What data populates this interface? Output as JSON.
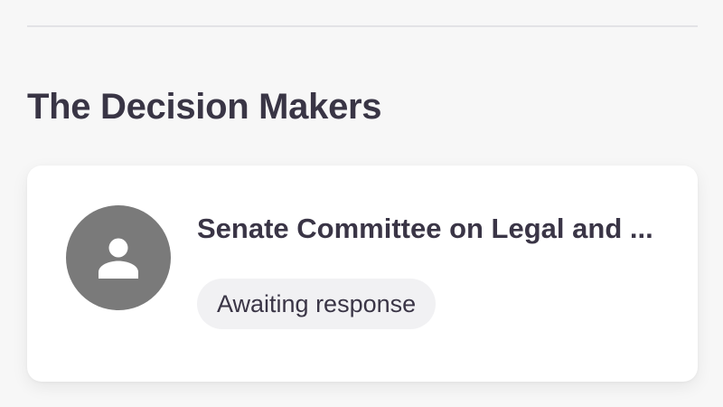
{
  "section": {
    "title": "The Decision Makers"
  },
  "decision_maker": {
    "name": "Senate Committee on Legal and ...",
    "avatar_icon": "person-icon",
    "status": "Awaiting response"
  },
  "colors": {
    "avatar_bg": "#7a7a7a",
    "badge_bg": "#f1f1f3",
    "text": "#3a3546"
  }
}
